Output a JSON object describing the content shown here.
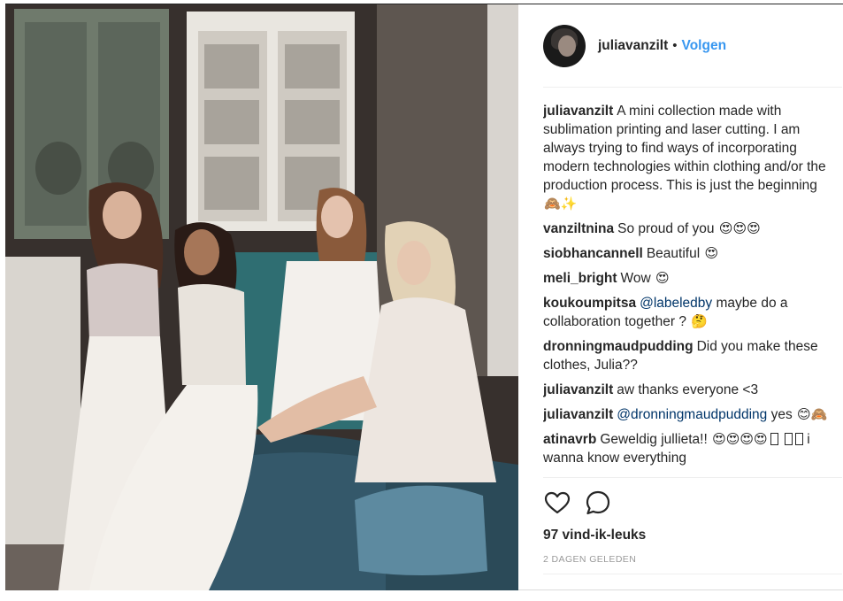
{
  "post": {
    "author": "juliavanzilt",
    "separator": "•",
    "follow_label": "Volgen",
    "caption": "A mini collection made with sublimation printing and laser cutting. I am always trying to find ways of incorporating modern technologies within clothing and/or the production process. This is just the beginning",
    "caption_emoji": "🙈✨",
    "likes_text": "97 vind-ik-leuks",
    "timestamp": "2 DAGEN GELEDEN"
  },
  "comments": [
    {
      "user": "vanziltnina",
      "text": "So proud of you",
      "emoji": "😍😍😍"
    },
    {
      "user": "siobhancannell",
      "text": "Beautiful",
      "emoji": "😍"
    },
    {
      "user": "meli_bright",
      "text": "Wow",
      "emoji": "😍"
    },
    {
      "user": "koukoumpitsa",
      "mention": "@labeledby",
      "text": "maybe do a collaboration together ?",
      "emoji": "🤔"
    },
    {
      "user": "dronningmaudpudding",
      "text": "Did you make these clothes, Julia??"
    },
    {
      "user": "juliavanzilt",
      "text": "aw thanks everyone <3"
    },
    {
      "user": "juliavanzilt",
      "mention": "@dronningmaudpudding",
      "text": "yes",
      "emoji": "😊🙈"
    },
    {
      "user": "atinavrb",
      "text": "Geweldig jullieta!!",
      "emoji": "😍😍😍😍",
      "more": "i wanna know everything"
    }
  ],
  "icons": {
    "like": "heart-icon",
    "comment": "comment-bubble-icon"
  },
  "colors": {
    "link": "#3897f0",
    "mention": "#003569",
    "muted": "#999999"
  }
}
